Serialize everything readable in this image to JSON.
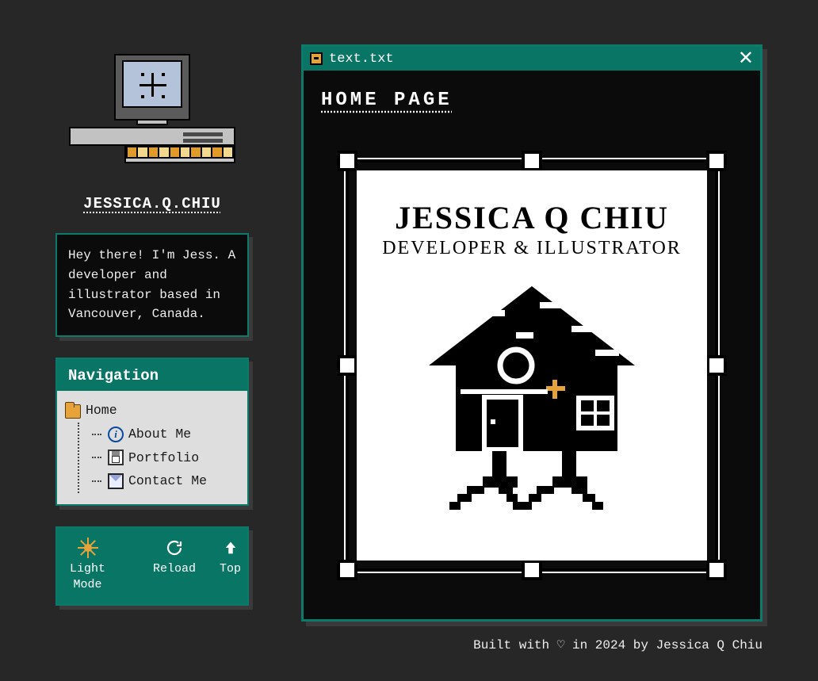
{
  "brand": "JESSICA.Q.CHIU",
  "intro": "Hey there! I'm Jess. A developer and illustrator based in Vancouver, Canada.",
  "nav": {
    "title": "Navigation",
    "home_label": "Home",
    "items": [
      {
        "label": "About Me",
        "icon": "info"
      },
      {
        "label": "Portfolio",
        "icon": "floppy"
      },
      {
        "label": "Contact Me",
        "icon": "mail"
      }
    ]
  },
  "actions": {
    "theme_label": "Light\nMode",
    "reload_label": "Reload",
    "top_label": "Top"
  },
  "window": {
    "filename": "text.txt",
    "crumb": "HOME PAGE"
  },
  "poster": {
    "title": "JESSICA Q CHIU",
    "subtitle": "DEVELOPER & ILLUSTRATOR"
  },
  "footer": "Built with ♡ in 2024 by Jessica Q Chiu"
}
